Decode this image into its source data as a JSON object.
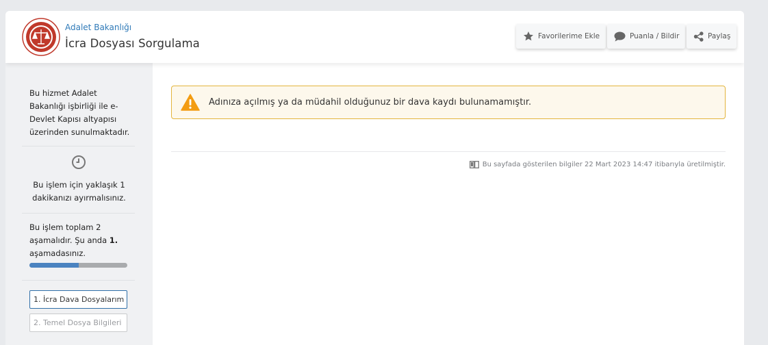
{
  "header": {
    "org_name": "Adalet Bakanlığı",
    "service_title": "İcra Dosyası Sorgulama",
    "buttons": {
      "favorite": "Favorilerime Ekle",
      "rate": "Puanla / Bildir",
      "share": "Paylaş"
    }
  },
  "sidebar": {
    "info_text": "Bu hizmet Adalet Bakanlığı işbirliği ile e-Devlet Kapısı altyapısı üzerinden sunulmaktadır.",
    "time_text": "Bu işlem için yaklaşık 1 dakikanızı ayırmalısınız.",
    "stage_text_prefix": "Bu işlem toplam 2 aşamalıdır. Şu anda ",
    "stage_current": "1.",
    "stage_text_suffix": " aşamadasınız.",
    "progress_fraction": 0.5,
    "steps": [
      "1. İcra Dava Dosyalarım",
      "2. Temel Dosya Bilgileri"
    ]
  },
  "main": {
    "alert_text": "Adınıza açılmış ya da müdahil olduğunuz bir dava kaydı bulunamamıştır.",
    "footnote": "Bu sayfada gösterilen bilgiler 22 Mart 2023 14:47 itibarıyla üretilmiştir."
  },
  "colors": {
    "accent_blue": "#2f7ab8",
    "progress_blue": "#4b83c0",
    "alert_border": "#e3b43c",
    "warning_orange": "#f39c12",
    "logo_red": "#c0392b"
  },
  "icons": {
    "favorite": "star-icon",
    "rate": "speech-bubble-icon",
    "share": "share-icon",
    "time": "clock-icon",
    "alert": "warning-triangle-icon",
    "footnote": "book-icon"
  }
}
